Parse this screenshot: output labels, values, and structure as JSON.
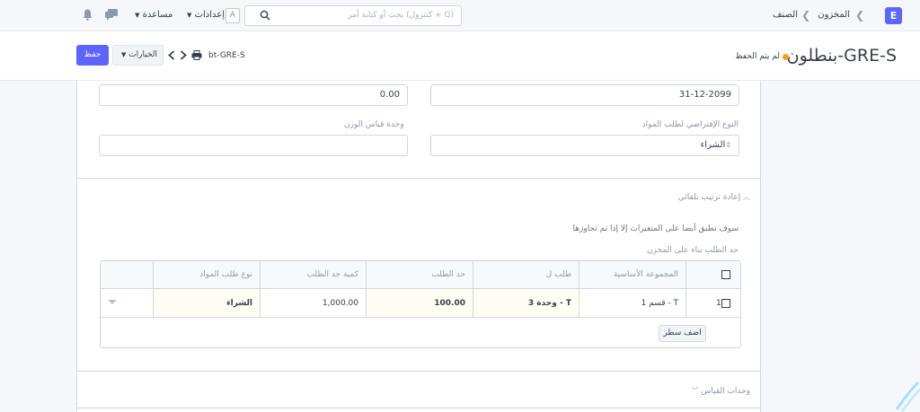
{
  "navbar": {
    "logo_letter": "E",
    "breadcrumbs": [
      "المخزون",
      "الصنف"
    ],
    "search_placeholder": "بحث أو كتابة أمر (كنترول + G)",
    "settings_label": "إعدادات",
    "help_label": "مساعدة",
    "avatar_letter": "A"
  },
  "page_head": {
    "title": "بنطلون-GRE-S",
    "status": "لم يتم الحفظ",
    "doc_name": "bt-GRE-S",
    "options_label": "الخيارات",
    "save_label": "حفظ"
  },
  "form": {
    "end_of_life_value": "31-12-2099",
    "weight_value": "0.00",
    "default_material_request_type_label": "النوع الإفتراضي لطلب المواد",
    "default_material_request_type_value": "الشراء",
    "weight_uom_label": "وحدة قياس الوزن",
    "weight_uom_value": ""
  },
  "reorder_section": {
    "title": "إعادة ترتيب تلقائي",
    "variant_note": "سوف تطبق أيضا على المتغيرات إلا إذا تم تجاوزها",
    "grid_label": "حد الطلب بناء على المخزن",
    "columns": [
      "المجموعة الأساسية",
      "طلب ل",
      "حد الطلب",
      "كمية حد الطلب",
      "نوع طلب المواد"
    ],
    "rows": [
      {
        "idx": "1",
        "group": "قسم 1 - T",
        "warehouse": "وحدة 3 - T",
        "level": "100.00",
        "qty": "1,000.00",
        "type": "الشراء"
      }
    ],
    "add_row_label": "اضف سطر"
  },
  "uom_section": {
    "title": "وحدات القياس"
  },
  "colors": {
    "primary": "#5e64ff",
    "unsaved_indicator": "#ffa00a"
  }
}
